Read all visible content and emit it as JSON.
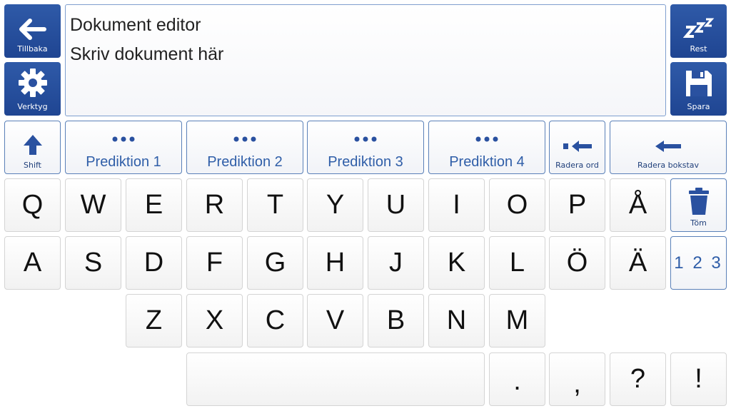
{
  "sidebar": {
    "back_label": "Tillbaka",
    "tools_label": "Verktyg"
  },
  "rightbar": {
    "rest_label": "Rest",
    "save_label": "Spara"
  },
  "editor": {
    "title": "Dokument editor",
    "body": "Skriv dokument här"
  },
  "controls": {
    "shift_label": "Shift",
    "predictions": [
      "Prediktion 1",
      "Prediktion 2",
      "Prediktion 3",
      "Prediktion 4"
    ],
    "delete_word_label": "Radera ord",
    "delete_letter_label": "Radera bokstav",
    "clear_label": "Töm",
    "numbers_label": "1 2 3"
  },
  "keys": {
    "row1": [
      "Q",
      "W",
      "E",
      "R",
      "T",
      "Y",
      "U",
      "I",
      "O",
      "P",
      "Å"
    ],
    "row2": [
      "A",
      "S",
      "D",
      "F",
      "G",
      "H",
      "J",
      "K",
      "L",
      "Ö",
      "Ä"
    ],
    "row3": [
      "Z",
      "X",
      "C",
      "V",
      "B",
      "N",
      "M"
    ],
    "row4": [
      ".",
      ",",
      "?",
      "!"
    ]
  },
  "colors": {
    "accent_dark": "#1f4592",
    "accent_text": "#2a5aa4",
    "key_border": "#d4d4d4"
  }
}
